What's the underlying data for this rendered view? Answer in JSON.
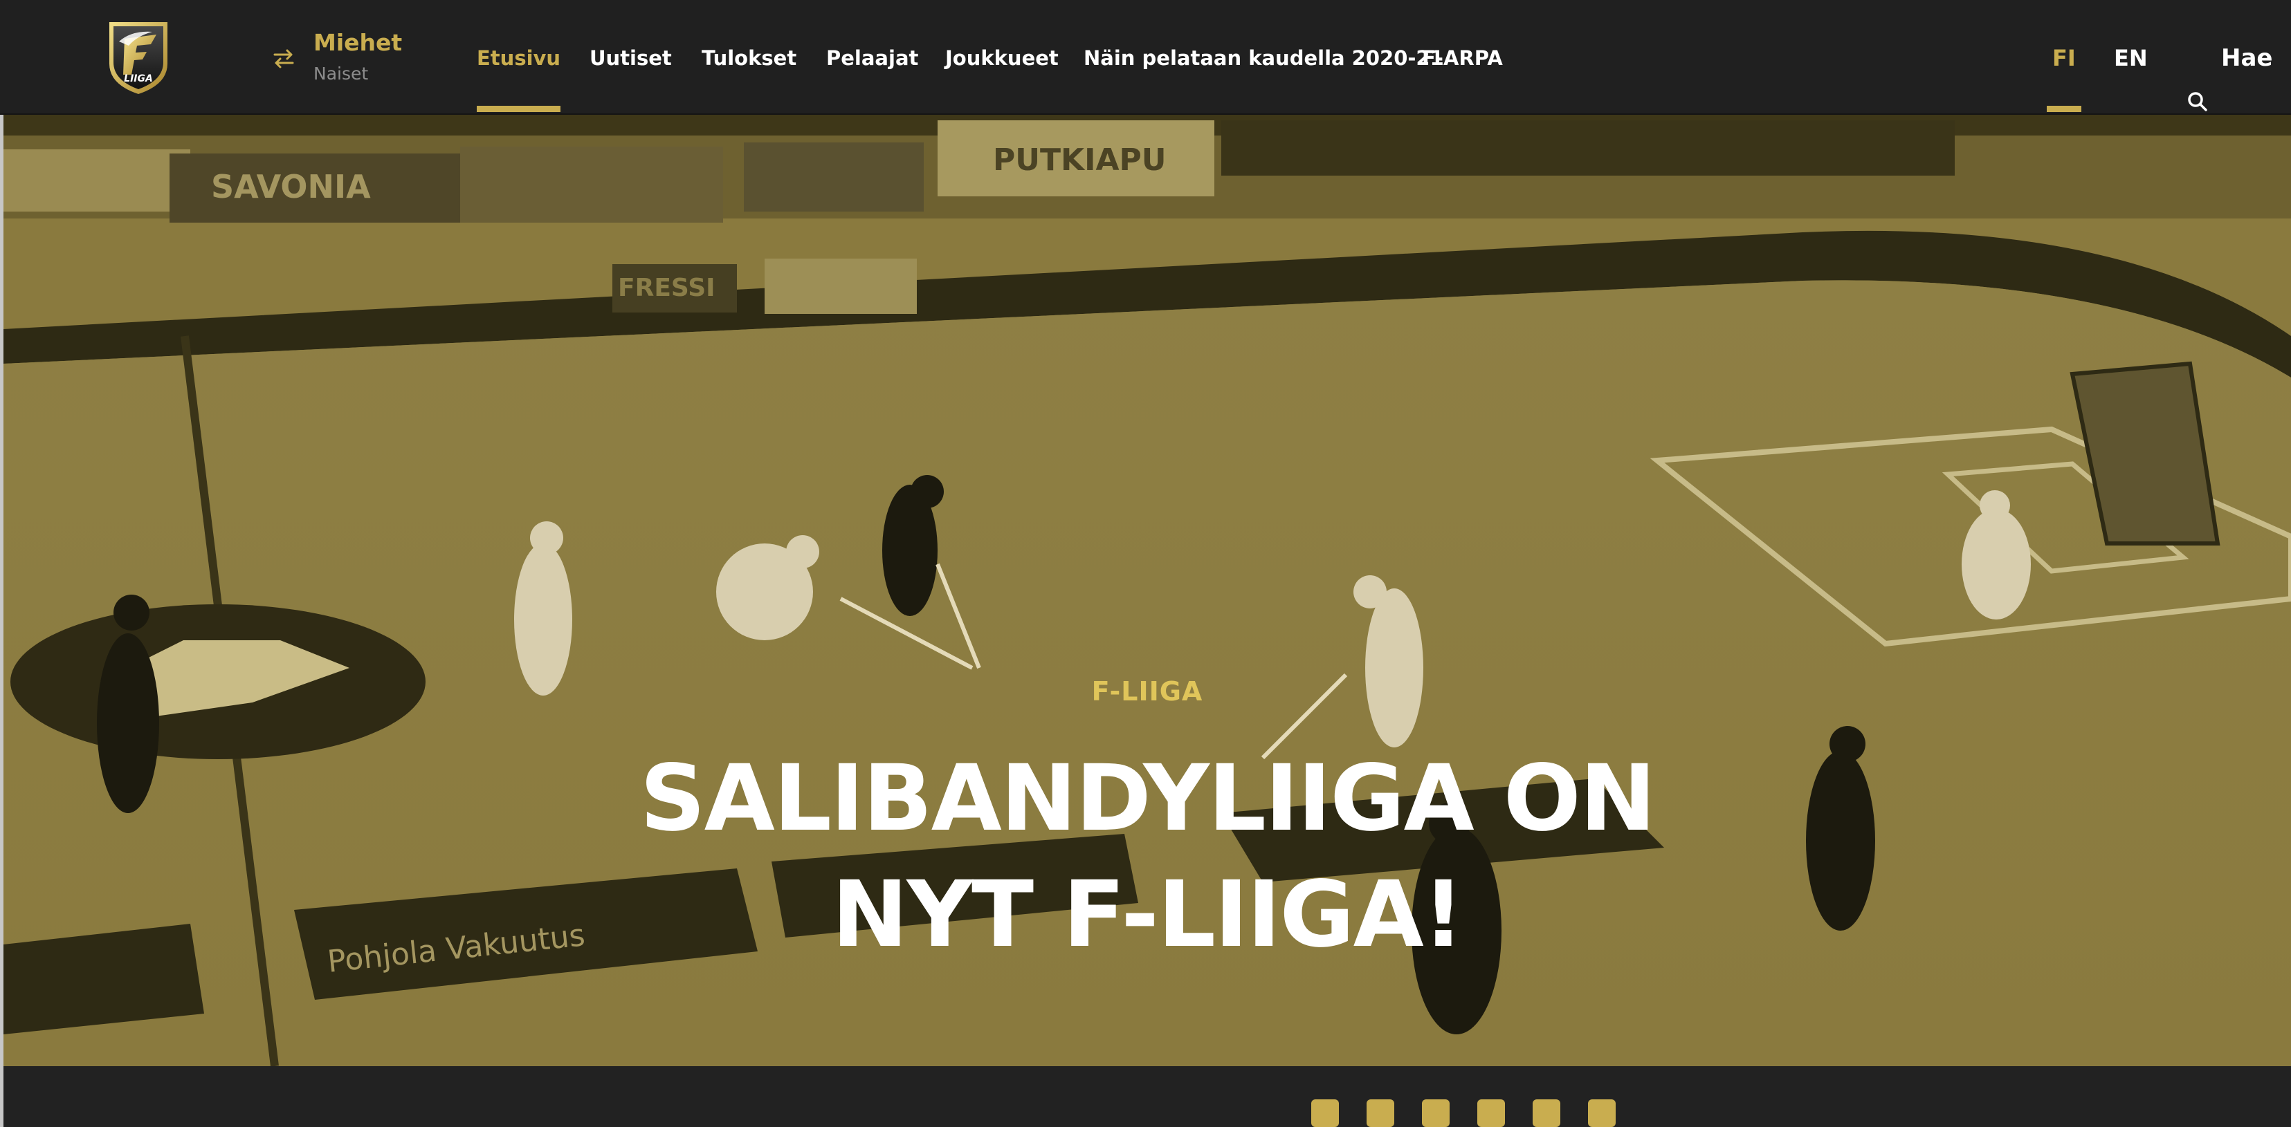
{
  "header": {
    "logo_text": "F LIIGA",
    "series_switch": {
      "primary": "Miehet",
      "secondary": "Naiset"
    },
    "nav": [
      {
        "label": "Etusivu",
        "active": true
      },
      {
        "label": "Uutiset",
        "active": false
      },
      {
        "label": "Tulokset",
        "active": false
      },
      {
        "label": "Pelaajat",
        "active": false
      },
      {
        "label": "Joukkueet",
        "active": false
      },
      {
        "label": "Näin pelataan kaudella 2020-21",
        "active": false
      },
      {
        "label": "F-ARPA",
        "active": false
      }
    ],
    "languages": [
      {
        "label": "FI",
        "active": true
      },
      {
        "label": "EN",
        "active": false
      }
    ],
    "search_label": "Hae"
  },
  "hero": {
    "category": "F-LIIGA",
    "title_line1": "SALIBANDYLIIGA ON",
    "title_line2": "NYT F-LIIGA!",
    "board_ads": [
      "SAVONIA",
      "Pohjola Vakuutus",
      "PUTKIAPU",
      "FRESSI"
    ]
  },
  "colors": {
    "accent": "#c9ad4f",
    "header_bg": "#202020",
    "hero_tint": "#8a7a3e"
  },
  "icons": {
    "switch": "swap-arrows-icon",
    "search": "search-icon"
  }
}
